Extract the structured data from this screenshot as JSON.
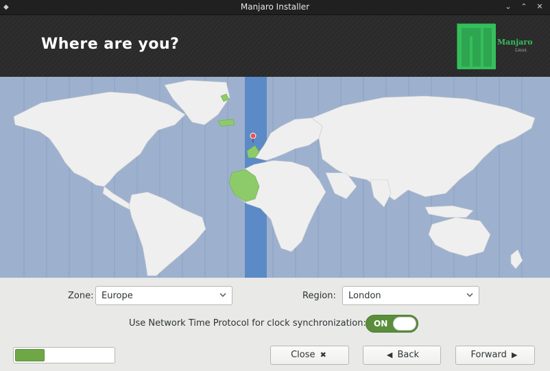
{
  "window": {
    "title": "Manjaro Installer",
    "min_glyph": "⌄",
    "max_glyph": "⌃",
    "close_glyph": "✕",
    "menu_glyph": "◆"
  },
  "header": {
    "title": "Where are you?",
    "logo_text": "Manjaro",
    "logo_sub": "Linux"
  },
  "map": {
    "selected_timezone_color": "#5b8ac6",
    "selected_region_color": "#8dcb6a",
    "ocean_color": "#9db1cf",
    "land_color": "#efefef",
    "pin_icon": "location-pin-icon"
  },
  "zone": {
    "label": "Zone:",
    "value": "Europe"
  },
  "region": {
    "label": "Region:",
    "value": "London"
  },
  "ntp": {
    "label": "Use Network Time Protocol for clock synchronization:",
    "toggle_text": "ON",
    "enabled": true
  },
  "progress": {
    "fraction": 0.3
  },
  "buttons": {
    "close_label": "Close",
    "close_icon": "✖",
    "back_label": "Back",
    "back_icon": "◀",
    "forward_label": "Forward",
    "forward_icon": "▶"
  }
}
